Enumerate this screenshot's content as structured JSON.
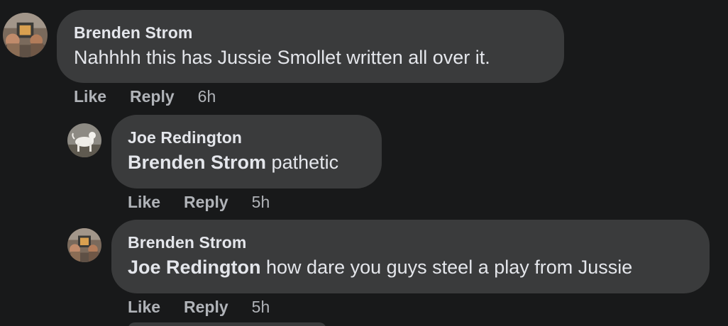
{
  "comments": [
    {
      "author": "Brenden Strom",
      "mention": "",
      "text": "Nahhhh this has Jussie Smollet written all over it.",
      "like_label": "Like",
      "reply_label": "Reply",
      "time": "6h",
      "avatar_icon": "profile-photo-fireplace"
    },
    {
      "author": "Joe Redington",
      "mention": "Brenden Strom",
      "text": "pathetic",
      "like_label": "Like",
      "reply_label": "Reply",
      "time": "5h",
      "avatar_icon": "profile-photo-dog"
    },
    {
      "author": "Brenden Strom",
      "mention": "Joe Redington",
      "text": "how dare you guys steel a play from Jussie",
      "like_label": "Like",
      "reply_label": "Reply",
      "time": "5h",
      "avatar_icon": "profile-photo-fireplace"
    }
  ],
  "colors": {
    "background": "#18191a",
    "bubble": "#3a3b3c",
    "primary_text": "#e4e6eb",
    "secondary_text": "#b0b3b8"
  }
}
